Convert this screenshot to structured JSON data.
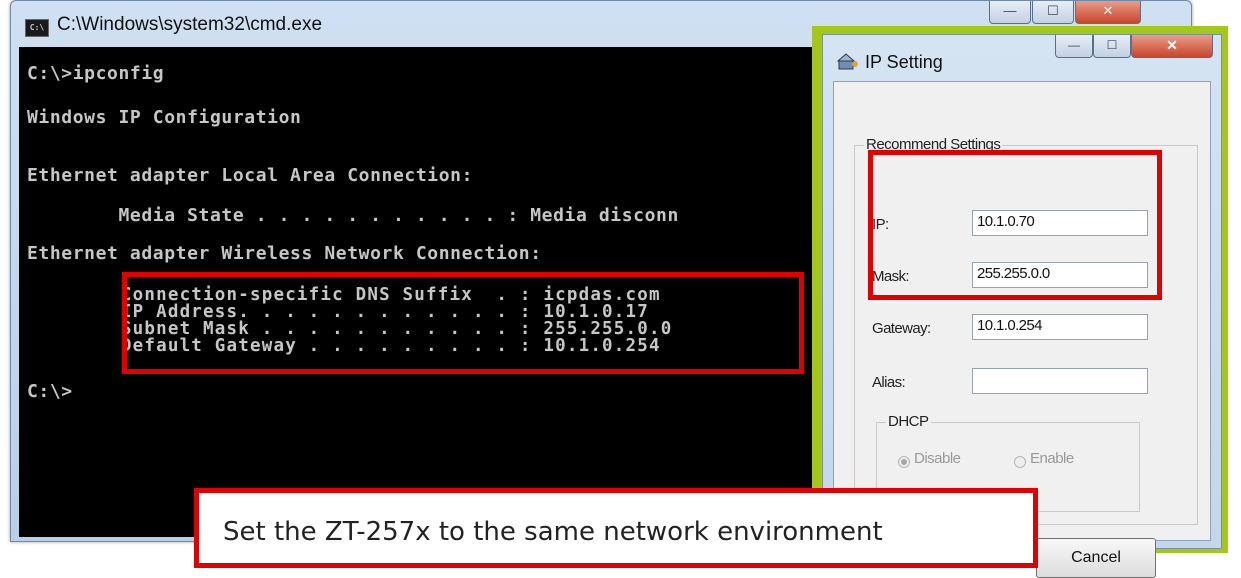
{
  "cmd_window": {
    "title": "C:\\Windows\\system32\\cmd.exe",
    "icon_text": "C:\\",
    "lines": [
      "C:\\>ipconfig",
      "Windows IP Configuration",
      "Ethernet adapter Local Area Connection:",
      "        Media State . . . . . . . . . . . : Media disconn",
      "Ethernet adapter Wireless Network Connection:",
      "        Connection-specific DNS Suffix  . : icpdas.com",
      "        IP Address. . . . . . . . . . . . : 10.1.0.17",
      "        Subnet Mask . . . . . . . . . . . : 255.255.0.0",
      "        Default Gateway . . . . . . . . . : 10.1.0.254",
      "C:\\>"
    ],
    "controls": {
      "minimize": "—",
      "maximize": "☐",
      "close": "✕"
    }
  },
  "ip_dialog": {
    "title": "IP Setting",
    "group_recommend": "Recommend Settings",
    "fields": {
      "ip": {
        "label": "IP:",
        "value": "10.1.0.70"
      },
      "mask": {
        "label": "Mask:",
        "value": "255.255.0.0"
      },
      "gateway": {
        "label": "Gateway:",
        "value": "10.1.0.254"
      },
      "alias": {
        "label": "Alias:",
        "value": ""
      }
    },
    "group_dhcp": "DHCP",
    "dhcp_options": {
      "disable": "Disable",
      "enable": "Enable",
      "selected": "Disable"
    },
    "cancel_label": "Cancel",
    "controls": {
      "minimize": "—",
      "maximize": "☐",
      "close": "✕"
    }
  },
  "caption": "Set the ZT-257x to the same network environment",
  "colors": {
    "highlight": "#e00000",
    "frame": "#a3c81a",
    "console_bg": "#000000"
  }
}
